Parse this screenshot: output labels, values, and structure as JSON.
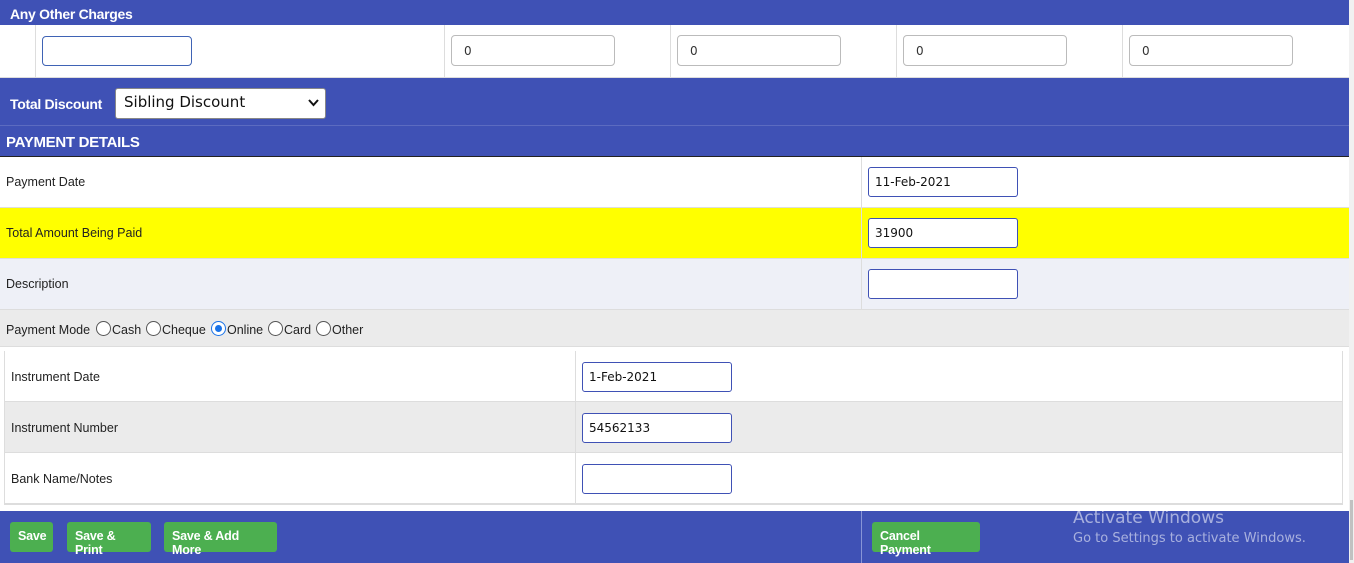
{
  "charges": {
    "title": "Any Other Charges",
    "name_value": "",
    "amounts": [
      "0",
      "0",
      "0",
      "0"
    ]
  },
  "discount": {
    "label": "Total Discount",
    "selected": "Sibling Discount"
  },
  "payment": {
    "header": "PAYMENT DETAILS",
    "date_label": "Payment Date",
    "date_value": "11-Feb-2021",
    "amount_label": "Total Amount Being Paid",
    "amount_value": "31900",
    "description_label": "Description",
    "description_value": "",
    "mode_label": "Payment Mode",
    "modes": [
      "Cash",
      "Cheque",
      "Online",
      "Card",
      "Other"
    ],
    "selected_mode": "Online"
  },
  "instrument": {
    "date_label": "Instrument Date",
    "date_value": "1-Feb-2021",
    "number_label": "Instrument Number",
    "number_value": "54562133",
    "bank_label": "Bank Name/Notes",
    "bank_value": ""
  },
  "buttons": {
    "save": "Save",
    "save_print": "Save & Print",
    "save_add": "Save & Add More",
    "cancel": "Cancel Payment"
  },
  "watermark": {
    "line1": "Activate Windows",
    "line2": "Go to Settings to activate Windows."
  },
  "colors": {
    "header_blue": "#3f51b5",
    "highlight_yellow": "#ffff00",
    "button_green": "#4caf50"
  }
}
